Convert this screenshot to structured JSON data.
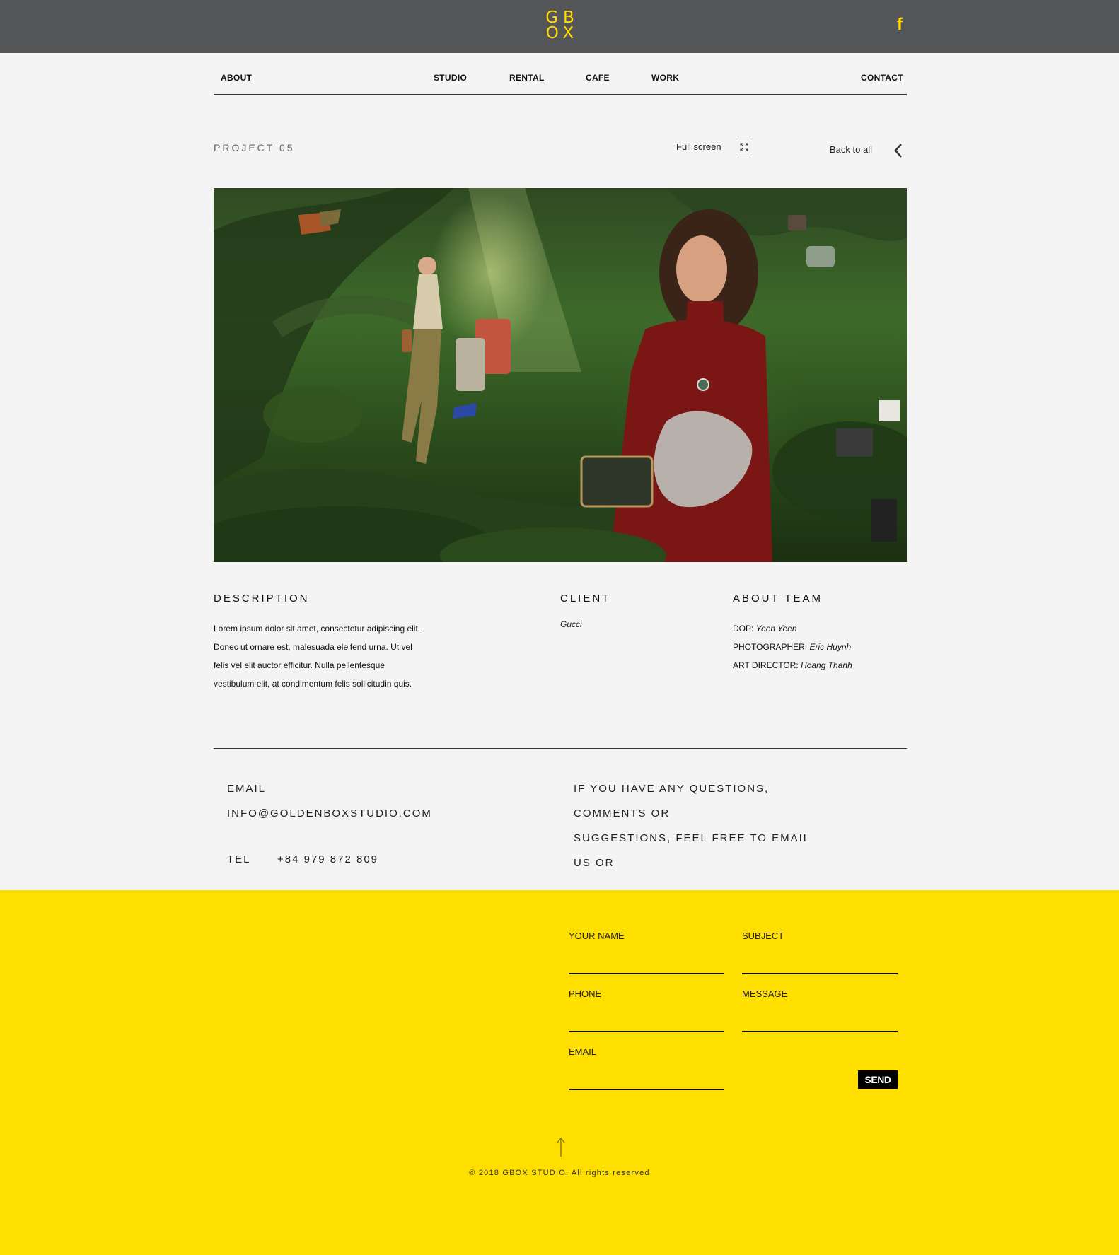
{
  "header": {
    "logo_line1": "GB",
    "logo_line2": "OX",
    "social_icon": "facebook-icon",
    "social_glyph": "f"
  },
  "nav": {
    "items": [
      "ABOUT",
      "STUDIO",
      "RENTAL",
      "CAFE",
      "WORK",
      "CONTACT"
    ]
  },
  "project": {
    "title": "PROJECT 05",
    "fullscreen_label": "Full screen",
    "fullscreen_icon": "expand-icon",
    "back_label": "Back to all",
    "back_icon": "chevron-left-icon",
    "image_alt": "forest fashion campaign photo"
  },
  "details": {
    "description_heading": "DESCRIPTION",
    "description_lines": [
      "Lorem ipsum dolor sit amet, consectetur adipiscing elit.",
      "Donec ut ornare est, malesuada eleifend urna. Ut vel",
      "felis vel elit auctor efficitur. Nulla pellentesque",
      "vestibulum elit, at condimentum felis sollicitudin quis."
    ],
    "client_heading": "CLIENT",
    "client_name": "Gucci",
    "team_heading": "ABOUT TEAM",
    "team": [
      {
        "role": "DOP:",
        "name": "Yeen Yeen"
      },
      {
        "role": "PHOTOGRAPHER:",
        "name": "Eric Huynh"
      },
      {
        "role": "ART DIRECTOR:",
        "name": "Hoang Thanh"
      }
    ]
  },
  "contact": {
    "email_label": "EMAIL",
    "email_value": "INFO@GOLDENBOXSTUDIO.COM",
    "tel_label": "TEL",
    "tel_value": "+84 979 872 809",
    "message_lines": [
      "IF YOU HAVE ANY QUESTIONS,",
      "COMMENTS OR",
      "SUGGESTIONS, FEEL FREE TO EMAIL",
      "US OR"
    ]
  },
  "form": {
    "your_name_label": "YOUR NAME",
    "subject_label": "SUBJECT",
    "phone_label": "PHONE",
    "message_label": "MESSAGE",
    "email_label": "EMAIL",
    "send_label": "SEND"
  },
  "footer": {
    "up_icon": "arrow-up-icon",
    "copyright": "© 2018 GBOX STUDIO. All rights reserved"
  },
  "colors": {
    "accent_yellow": "#ffdf00",
    "header_bg": "#545556",
    "page_bg": "#f4f4f4"
  }
}
